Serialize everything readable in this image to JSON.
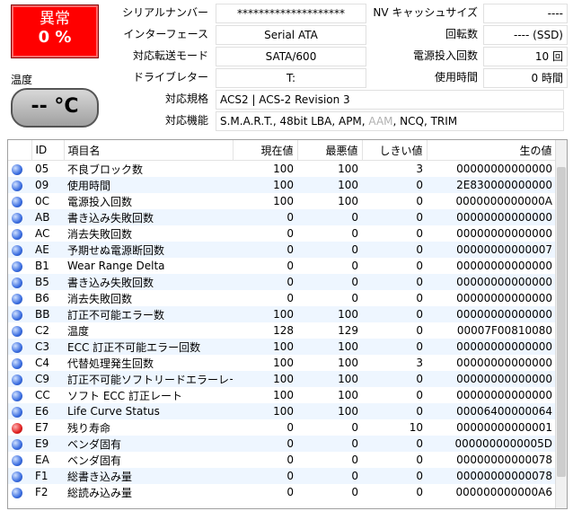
{
  "health": {
    "status": "異常",
    "percent": "0 %",
    "color": "#ff0000"
  },
  "temperature": {
    "label": "温度",
    "value": "-- °C"
  },
  "info": {
    "serial_label": "シリアルナンバー",
    "serial_value": "********************",
    "interface_label": "インターフェース",
    "interface_value": "Serial ATA",
    "transfer_label": "対応転送モード",
    "transfer_value": "SATA/600",
    "drive_letter_label": "ドライブレター",
    "drive_letter_value": "T:",
    "standard_label": "対応規格",
    "standard_value": "ACS2 | ACS-2 Revision 3",
    "features_label": "対応機能",
    "features_value_a": "S.M.A.R.T., 48bit LBA, APM, ",
    "features_value_aam": "AAM",
    "features_value_b": ", NCQ, TRIM",
    "nv_cache_label": "NV キャッシュサイズ",
    "nv_cache_value": "----",
    "rotation_label": "回転数",
    "rotation_value": "---- (SSD)",
    "power_on_count_label": "電源投入回数",
    "power_on_count_value": "10 回",
    "power_on_hours_label": "使用時間",
    "power_on_hours_value": "0 時間"
  },
  "table": {
    "headers": {
      "id": "ID",
      "name": "項目名",
      "current": "現在値",
      "worst": "最悪値",
      "threshold": "しきい値",
      "raw": "生の値"
    },
    "rows": [
      {
        "status": "good",
        "id": "05",
        "name": "不良ブロック数",
        "current": "100",
        "worst": "100",
        "threshold": "3",
        "raw": "00000000000000"
      },
      {
        "status": "good",
        "id": "09",
        "name": "使用時間",
        "current": "100",
        "worst": "100",
        "threshold": "0",
        "raw": "2E830000000000"
      },
      {
        "status": "good",
        "id": "0C",
        "name": "電源投入回数",
        "current": "100",
        "worst": "100",
        "threshold": "0",
        "raw": "0000000000000A"
      },
      {
        "status": "good",
        "id": "AB",
        "name": "書き込み失敗回数",
        "current": "0",
        "worst": "0",
        "threshold": "0",
        "raw": "00000000000000"
      },
      {
        "status": "good",
        "id": "AC",
        "name": "消去失敗回数",
        "current": "0",
        "worst": "0",
        "threshold": "0",
        "raw": "00000000000000"
      },
      {
        "status": "good",
        "id": "AE",
        "name": "予期せぬ電源断回数",
        "current": "0",
        "worst": "0",
        "threshold": "0",
        "raw": "00000000000007"
      },
      {
        "status": "good",
        "id": "B1",
        "name": "Wear Range Delta",
        "current": "0",
        "worst": "0",
        "threshold": "0",
        "raw": "00000000000000"
      },
      {
        "status": "good",
        "id": "B5",
        "name": "書き込み失敗回数",
        "current": "0",
        "worst": "0",
        "threshold": "0",
        "raw": "00000000000000"
      },
      {
        "status": "good",
        "id": "B6",
        "name": "消去失敗回数",
        "current": "0",
        "worst": "0",
        "threshold": "0",
        "raw": "00000000000000"
      },
      {
        "status": "good",
        "id": "BB",
        "name": "訂正不可能エラー数",
        "current": "100",
        "worst": "100",
        "threshold": "0",
        "raw": "00000000000000"
      },
      {
        "status": "good",
        "id": "C2",
        "name": "温度",
        "current": "128",
        "worst": "129",
        "threshold": "0",
        "raw": "00007F00810080"
      },
      {
        "status": "good",
        "id": "C3",
        "name": "ECC 訂正不可能エラー回数",
        "current": "100",
        "worst": "100",
        "threshold": "0",
        "raw": "00000000000000"
      },
      {
        "status": "good",
        "id": "C4",
        "name": "代替処理発生回数",
        "current": "100",
        "worst": "100",
        "threshold": "3",
        "raw": "00000000000000"
      },
      {
        "status": "good",
        "id": "C9",
        "name": "訂正不可能ソフトリードエラーレート",
        "current": "100",
        "worst": "100",
        "threshold": "0",
        "raw": "00000000000000"
      },
      {
        "status": "good",
        "id": "CC",
        "name": "ソフト ECC 訂正レート",
        "current": "100",
        "worst": "100",
        "threshold": "0",
        "raw": "00000000000000"
      },
      {
        "status": "good",
        "id": "E6",
        "name": "Life Curve Status",
        "current": "100",
        "worst": "100",
        "threshold": "0",
        "raw": "00006400000064"
      },
      {
        "status": "bad",
        "id": "E7",
        "name": "残り寿命",
        "current": "0",
        "worst": "0",
        "threshold": "10",
        "raw": "00000000000001"
      },
      {
        "status": "good",
        "id": "E9",
        "name": "ベンダ固有",
        "current": "0",
        "worst": "0",
        "threshold": "0",
        "raw": "0000000000005D"
      },
      {
        "status": "good",
        "id": "EA",
        "name": "ベンダ固有",
        "current": "0",
        "worst": "0",
        "threshold": "0",
        "raw": "00000000000078"
      },
      {
        "status": "good",
        "id": "F1",
        "name": "総書き込み量",
        "current": "0",
        "worst": "0",
        "threshold": "0",
        "raw": "00000000000078"
      },
      {
        "status": "good",
        "id": "F2",
        "name": "総読み込み量",
        "current": "0",
        "worst": "0",
        "threshold": "0",
        "raw": "000000000000A6"
      }
    ]
  }
}
